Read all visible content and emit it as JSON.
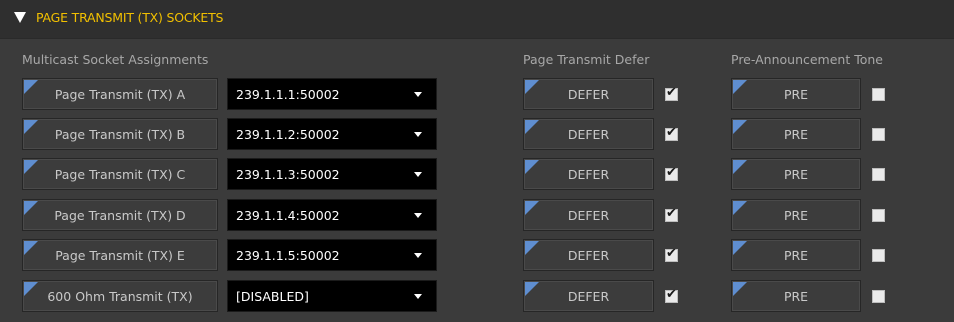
{
  "section": {
    "title": "PAGE TRANSMIT (TX) SOCKETS"
  },
  "columns": {
    "assignments": "Multicast Socket Assignments",
    "defer": "Page Transmit Defer",
    "tone": "Pre-Announcement Tone"
  },
  "rows": [
    {
      "label": "Page Transmit (TX) A",
      "socket": "239.1.1.1:50002",
      "defer_label": "DEFER",
      "defer_checked": true,
      "pre_label": "PRE",
      "pre_checked": false
    },
    {
      "label": "Page Transmit (TX) B",
      "socket": "239.1.1.2:50002",
      "defer_label": "DEFER",
      "defer_checked": true,
      "pre_label": "PRE",
      "pre_checked": false
    },
    {
      "label": "Page Transmit (TX) C",
      "socket": "239.1.1.3:50002",
      "defer_label": "DEFER",
      "defer_checked": true,
      "pre_label": "PRE",
      "pre_checked": false
    },
    {
      "label": "Page Transmit (TX) D",
      "socket": "239.1.1.4:50002",
      "defer_label": "DEFER",
      "defer_checked": true,
      "pre_label": "PRE",
      "pre_checked": false
    },
    {
      "label": "Page Transmit (TX) E",
      "socket": "239.1.1.5:50002",
      "defer_label": "DEFER",
      "defer_checked": true,
      "pre_label": "PRE",
      "pre_checked": false
    },
    {
      "label": "600 Ohm Transmit (TX)",
      "socket": "[DISABLED]",
      "defer_label": "DEFER",
      "defer_checked": true,
      "pre_label": "PRE",
      "pre_checked": false
    }
  ],
  "colors": {
    "accent": "#f2c000",
    "corner": "#5f8ed0"
  }
}
